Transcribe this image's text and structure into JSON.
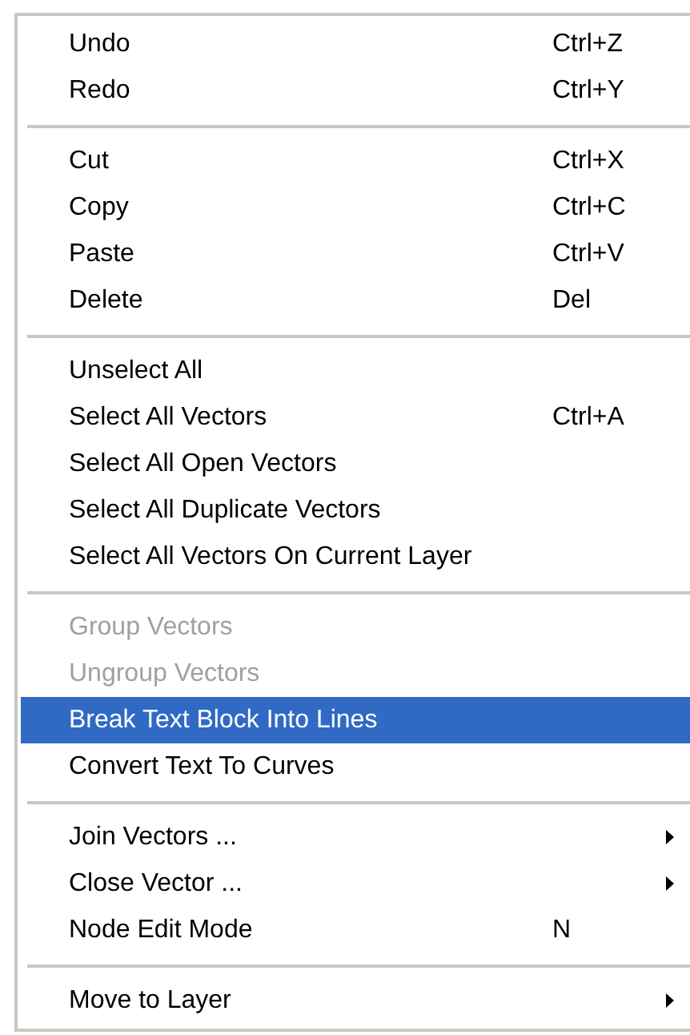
{
  "menu": {
    "groups": [
      {
        "items": [
          {
            "kind": "command",
            "label": "Undo",
            "shortcut": "Ctrl+Z",
            "disabled": false,
            "selected": false
          },
          {
            "kind": "command",
            "label": "Redo",
            "shortcut": "Ctrl+Y",
            "disabled": false,
            "selected": false
          }
        ]
      },
      {
        "items": [
          {
            "kind": "command",
            "label": "Cut",
            "shortcut": "Ctrl+X",
            "disabled": false,
            "selected": false
          },
          {
            "kind": "command",
            "label": "Copy",
            "shortcut": "Ctrl+C",
            "disabled": false,
            "selected": false
          },
          {
            "kind": "command",
            "label": "Paste",
            "shortcut": "Ctrl+V",
            "disabled": false,
            "selected": false
          },
          {
            "kind": "command",
            "label": "Delete",
            "shortcut": "Del",
            "disabled": false,
            "selected": false
          }
        ]
      },
      {
        "items": [
          {
            "kind": "command",
            "label": "Unselect All",
            "disabled": false,
            "selected": false
          },
          {
            "kind": "command",
            "label": "Select All Vectors",
            "shortcut": "Ctrl+A",
            "disabled": false,
            "selected": false
          },
          {
            "kind": "command",
            "label": "Select All Open Vectors",
            "disabled": false,
            "selected": false
          },
          {
            "kind": "command",
            "label": "Select All Duplicate Vectors",
            "disabled": false,
            "selected": false
          },
          {
            "kind": "command",
            "label": "Select All Vectors On Current Layer",
            "disabled": false,
            "selected": false
          }
        ]
      },
      {
        "items": [
          {
            "kind": "command",
            "label": "Group Vectors",
            "disabled": true,
            "selected": false
          },
          {
            "kind": "command",
            "label": "Ungroup Vectors",
            "disabled": true,
            "selected": false
          },
          {
            "kind": "command",
            "label": "Break Text Block Into Lines",
            "disabled": false,
            "selected": true
          },
          {
            "kind": "command",
            "label": "Convert Text To Curves",
            "disabled": false,
            "selected": false
          }
        ]
      },
      {
        "items": [
          {
            "kind": "submenu",
            "label": "Join Vectors ...",
            "disabled": false,
            "selected": false
          },
          {
            "kind": "submenu",
            "label": "Close Vector ...",
            "disabled": false,
            "selected": false
          },
          {
            "kind": "command",
            "label": "Node Edit Mode",
            "shortcut": "N",
            "disabled": false,
            "selected": false
          }
        ]
      },
      {
        "items": [
          {
            "kind": "submenu",
            "label": "Move to Layer",
            "disabled": false,
            "selected": false
          }
        ]
      }
    ]
  }
}
